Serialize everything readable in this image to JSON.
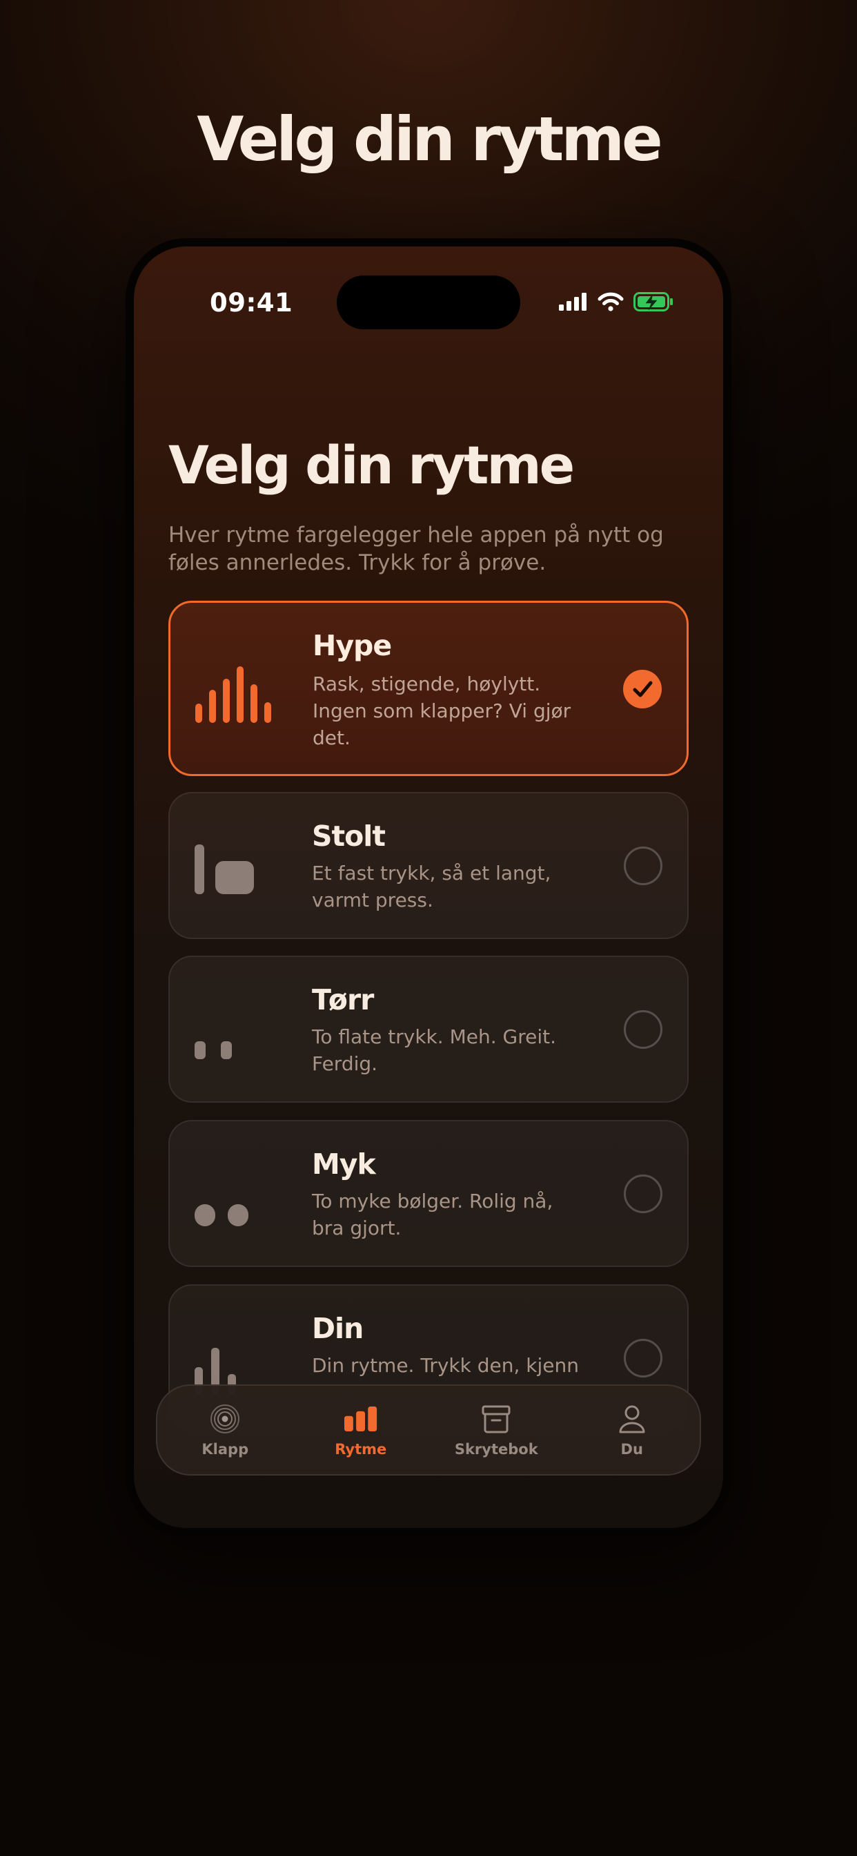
{
  "hero": {
    "title": "Velg din rytme"
  },
  "status_bar": {
    "time": "09:41"
  },
  "screen": {
    "title": "Velg din rytme",
    "subtitle": "Hver rytme fargelegger hele appen på nytt og føles annerledes. Trykk for å prøve."
  },
  "rhythms": [
    {
      "title": "Hype",
      "description": "Rask, stigende, høylytt. Ingen som klapper? Vi gjør det.",
      "selected": true,
      "icon": "rising-bars-icon"
    },
    {
      "title": "Stolt",
      "description": "Et fast trykk, så et langt, varmt press.",
      "selected": false,
      "icon": "tap-press-icon"
    },
    {
      "title": "Tørr",
      "description": "To flate trykk. Meh. Greit. Ferdig.",
      "selected": false,
      "icon": "two-flat-taps-icon"
    },
    {
      "title": "Myk",
      "description": "To myke bølger. Rolig nå, bra gjort.",
      "selected": false,
      "icon": "two-soft-waves-icon"
    },
    {
      "title": "Din",
      "description": "Din rytme. Trykk den, kjenn",
      "selected": false,
      "icon": "custom-rhythm-icon"
    }
  ],
  "tabs": [
    {
      "label": "Klapp",
      "icon": "target-icon",
      "active": false
    },
    {
      "label": "Rytme",
      "icon": "bars-icon",
      "active": true
    },
    {
      "label": "Skrytebok",
      "icon": "archive-box-icon",
      "active": false
    },
    {
      "label": "Du",
      "icon": "person-icon",
      "active": false
    }
  ],
  "colors": {
    "accent": "#F26A2E",
    "background": "#1E0F07",
    "text_primary": "#F8ECE0",
    "text_secondary": "#A08A7D",
    "battery": "#34C759"
  }
}
